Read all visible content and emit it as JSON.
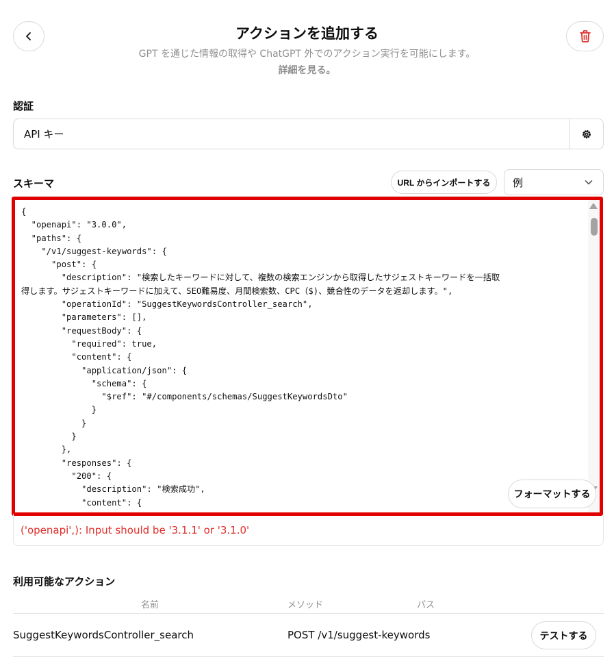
{
  "header": {
    "title": "アクションを追加する",
    "subtitle": "GPT を通じた情報の取得や ChatGPT 外でのアクション実行を可能にします。",
    "learn_more": "詳細を見る。"
  },
  "auth": {
    "label": "認証",
    "value": "API キー"
  },
  "schema": {
    "label": "スキーマ",
    "import_label": "URL からインポートする",
    "example_value": "例",
    "format_label": "フォーマットする",
    "code_lines": [
      "{",
      "  \"openapi\": \"3.0.0\",",
      "  \"paths\": {",
      "    \"/v1/suggest-keywords\": {",
      "      \"post\": {",
      "        \"description\": \"検索したキーワードに対して、複数の検索エンジンから取得したサジェストキーワードを一括取",
      "得します。サジェストキーワードに加えて、SEO難易度、月間検索数、CPC（$)、競合性のデータを返却します。\",",
      "        \"operationId\": \"SuggestKeywordsController_search\",",
      "        \"parameters\": [],",
      "        \"requestBody\": {",
      "          \"required\": true,",
      "          \"content\": {",
      "            \"application/json\": {",
      "              \"schema\": {",
      "                \"$ref\": \"#/components/schemas/SuggestKeywordsDto\"",
      "              }",
      "            }",
      "          }",
      "        },",
      "        \"responses\": {",
      "          \"200\": {",
      "            \"description\": \"検索成功\",",
      "            \"content\": {"
    ],
    "error": "('openapi',): Input should be '3.1.1' or '3.1.0'"
  },
  "actions": {
    "label": "利用可能なアクション",
    "columns": [
      "名前",
      "メソッド",
      "パス"
    ],
    "rows": [
      {
        "name": "SuggestKeywordsController_search",
        "method_path": "POST /v1/suggest-keywords",
        "test_label": "テストする"
      }
    ]
  },
  "colors": {
    "highlight_border": "#e00000",
    "error_text": "#e02e2a",
    "delete_icon": "#e02e2a",
    "muted_text": "#8f8f8f"
  },
  "icons": {
    "back": "chevron-left-icon",
    "delete": "trash-icon",
    "settings": "gear-icon",
    "dropdown": "chevron-down-icon"
  }
}
